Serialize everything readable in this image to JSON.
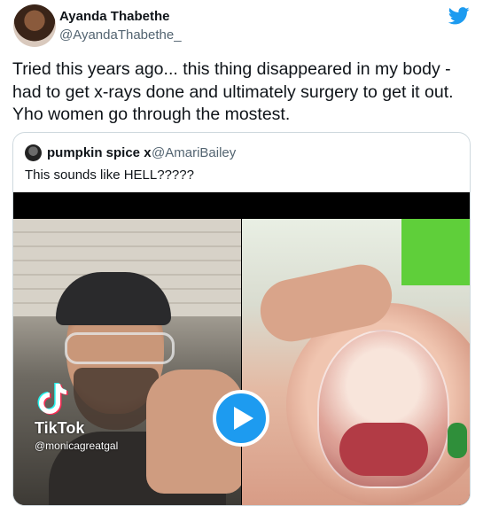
{
  "tweet": {
    "author_name": "Ayanda Thabethe",
    "author_handle": "@AyandaThabethe_",
    "text": "Tried this years ago... this thing disappeared in my body - had to get x-rays done and ultimately surgery to get it out. Yho women go through the mostest."
  },
  "quoted_tweet": {
    "author_name": "pumpkin spice x",
    "author_handle": "@AmariBailey",
    "text": "This sounds like HELL?????"
  },
  "video": {
    "watermark_app": "TikTok",
    "watermark_handle": "@monicagreatgal"
  },
  "icons": {
    "brand": "twitter-bird-icon",
    "play": "play-icon",
    "tiktok_logo": "tiktok-logo-icon"
  },
  "colors": {
    "accent": "#1d9bf0",
    "text_primary": "#0f1419",
    "text_secondary": "#536471",
    "border": "#cfd9de"
  }
}
